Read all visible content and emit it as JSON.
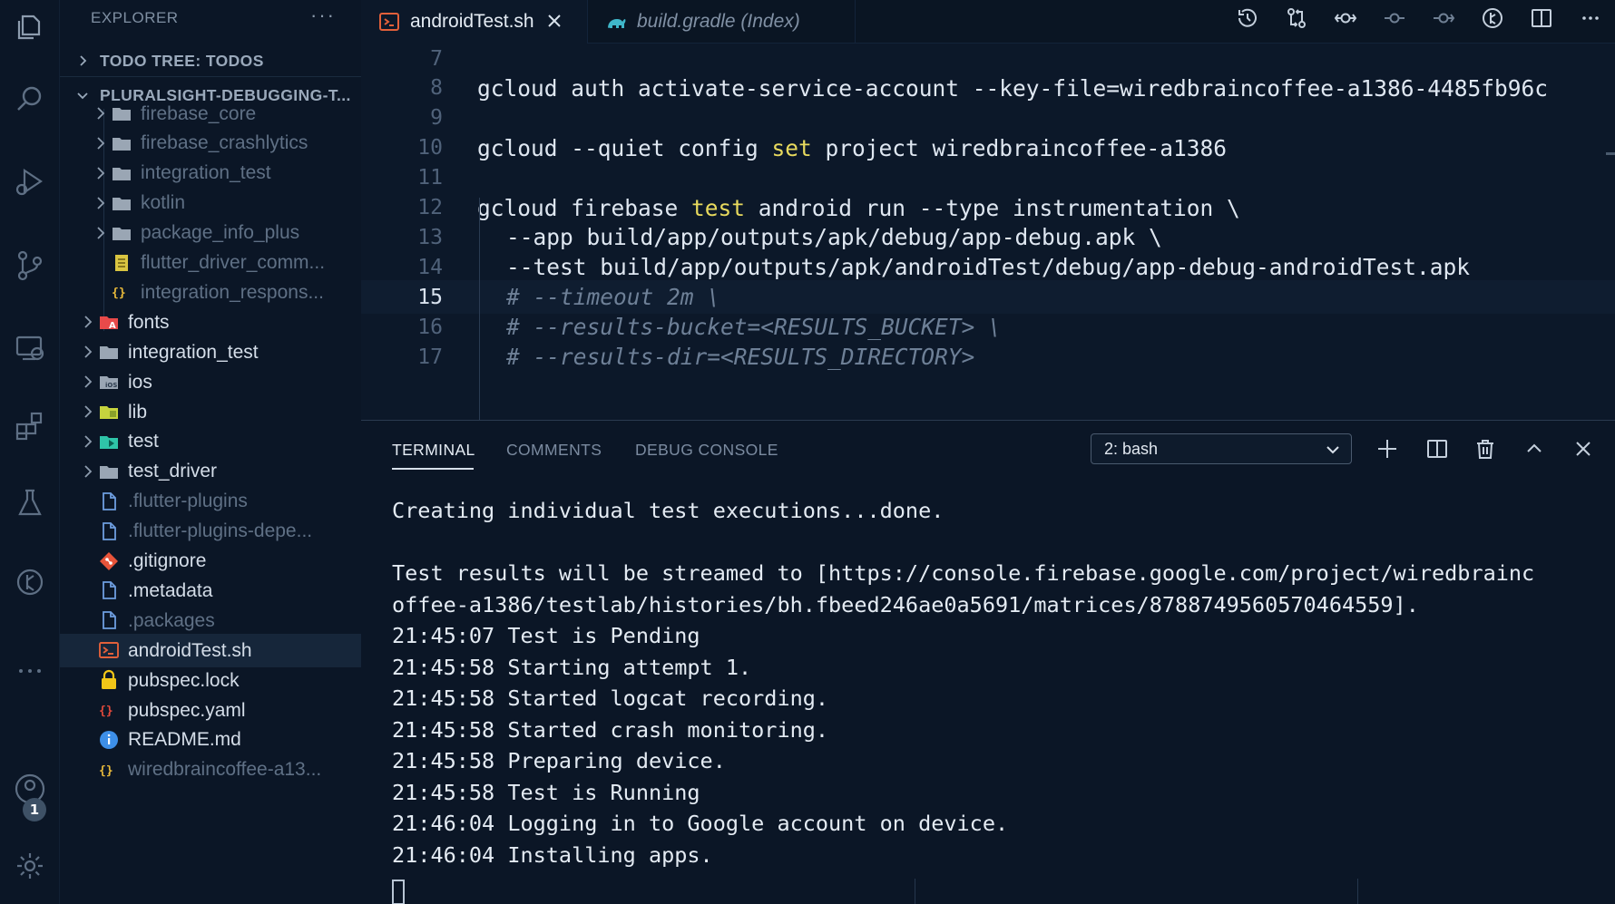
{
  "activity_bar": {
    "items": [
      "explorer-icon",
      "search-icon",
      "run-debug-icon",
      "source-control-icon",
      "remote-explorer-icon",
      "extensions-icon",
      "testing-icon",
      "timeline-icon",
      "more-icon"
    ],
    "accounts_badge": "1"
  },
  "sidebar": {
    "title": "EXPLORER",
    "more": "···",
    "sections": [
      {
        "label": "TODO TREE: TODOS"
      },
      {
        "label": "PLURALSIGHT-DEBUGGING-T..."
      }
    ],
    "tree": [
      {
        "label": "firebase_core",
        "kind": "folder",
        "depth": 2,
        "dim": true
      },
      {
        "label": "firebase_crashlytics",
        "kind": "folder",
        "depth": 2,
        "dim": true
      },
      {
        "label": "integration_test",
        "kind": "folder",
        "depth": 2,
        "dim": true
      },
      {
        "label": "kotlin",
        "kind": "folder",
        "depth": 2,
        "dim": true
      },
      {
        "label": "package_info_plus",
        "kind": "folder",
        "depth": 2,
        "dim": true
      },
      {
        "label": "flutter_driver_comm...",
        "kind": "file-lines",
        "depth": 2,
        "dim": true
      },
      {
        "label": "integration_respons...",
        "kind": "json",
        "depth": 2,
        "dim": true
      },
      {
        "label": "fonts",
        "kind": "folder-fonts",
        "depth": 1,
        "dim": false
      },
      {
        "label": "integration_test",
        "kind": "folder",
        "depth": 1,
        "dim": false
      },
      {
        "label": "ios",
        "kind": "folder-ios",
        "depth": 1,
        "dim": false
      },
      {
        "label": "lib",
        "kind": "folder-lib",
        "depth": 1,
        "dim": false
      },
      {
        "label": "test",
        "kind": "folder-test",
        "depth": 1,
        "dim": false
      },
      {
        "label": "test_driver",
        "kind": "folder",
        "depth": 1,
        "dim": false
      },
      {
        "label": ".flutter-plugins",
        "kind": "file",
        "depth": 1,
        "dim": true
      },
      {
        "label": ".flutter-plugins-depe...",
        "kind": "file",
        "depth": 1,
        "dim": true
      },
      {
        "label": ".gitignore",
        "kind": "git",
        "depth": 1,
        "dim": false
      },
      {
        "label": ".metadata",
        "kind": "file",
        "depth": 1,
        "dim": false
      },
      {
        "label": ".packages",
        "kind": "file",
        "depth": 1,
        "dim": true
      },
      {
        "label": "androidTest.sh",
        "kind": "shell",
        "depth": 1,
        "dim": false,
        "selected": true
      },
      {
        "label": "pubspec.lock",
        "kind": "lock",
        "depth": 1,
        "dim": false
      },
      {
        "label": "pubspec.yaml",
        "kind": "yaml",
        "depth": 1,
        "dim": false
      },
      {
        "label": "README.md",
        "kind": "info",
        "depth": 1,
        "dim": false
      },
      {
        "label": "wiredbraincoffee-a13...",
        "kind": "json",
        "depth": 1,
        "dim": true
      }
    ]
  },
  "editor": {
    "tabs": [
      {
        "label": "androidTest.sh",
        "active": true
      },
      {
        "label": "build.gradle (Index)",
        "active": false
      }
    ],
    "actions": [
      "history-icon",
      "compare-changes-icon",
      "git-commit-icon",
      "previous-change-icon",
      "next-change-icon",
      "git-graph-icon",
      "split-editor-icon",
      "more-actions-icon"
    ],
    "current_line": "15",
    "lines": [
      {
        "num": "7",
        "text": ""
      },
      {
        "num": "8",
        "text": "gcloud auth activate-service-account --key-file=wiredbraincoffee-a1386-4485fb96c"
      },
      {
        "num": "9",
        "text": ""
      },
      {
        "num": "10",
        "before": "gcloud --quiet config ",
        "kw": "set",
        "after": " project wiredbraincoffee-a1386"
      },
      {
        "num": "11",
        "text": ""
      },
      {
        "num": "12",
        "before": "gcloud firebase ",
        "kw": "test",
        "after": " android run --type instrumentation \\"
      },
      {
        "num": "13",
        "text": "--app build/app/outputs/apk/debug/app-debug.apk \\",
        "cont": true
      },
      {
        "num": "14",
        "text": "--test build/app/outputs/apk/androidTest/debug/app-debug-androidTest.apk",
        "cont": true
      },
      {
        "num": "15",
        "text": "# --timeout 2m \\",
        "cont": true,
        "comment": true
      },
      {
        "num": "16",
        "text": "# --results-bucket=<RESULTS_BUCKET> \\",
        "cont": true,
        "comment": true
      },
      {
        "num": "17",
        "text": "# --results-dir=<RESULTS_DIRECTORY>",
        "cont": true,
        "comment": true
      }
    ]
  },
  "panel": {
    "tabs": [
      "TERMINAL",
      "COMMENTS",
      "DEBUG CONSOLE"
    ],
    "active_tab": "TERMINAL",
    "terminal_select": "2: bash",
    "actions": [
      "add-terminal-icon",
      "split-terminal-icon",
      "kill-terminal-icon",
      "maximize-panel-icon",
      "close-panel-icon"
    ],
    "terminal_lines": [
      "Creating individual test executions...done.",
      "",
      "Test results will be streamed to [https://console.firebase.google.com/project/wiredbrainc",
      "offee-a1386/testlab/histories/bh.fbeed246ae0a5691/matrices/8788749560570464559].",
      "21:45:07 Test is Pending",
      "21:45:58 Starting attempt 1.",
      "21:45:58 Started logcat recording.",
      "21:45:58 Started crash monitoring.",
      "21:45:58 Preparing device.",
      "21:45:58 Test is Running",
      "21:46:04 Logging in to Google account on device.",
      "21:46:04 Installing apps."
    ]
  },
  "colors": {
    "background": "#0b1626",
    "editor_bg": "#0c1829",
    "keyword": "#e8da5e",
    "comment": "#6e8097",
    "folder": "#9aa6b4",
    "shell_icon": "#e2603a"
  }
}
